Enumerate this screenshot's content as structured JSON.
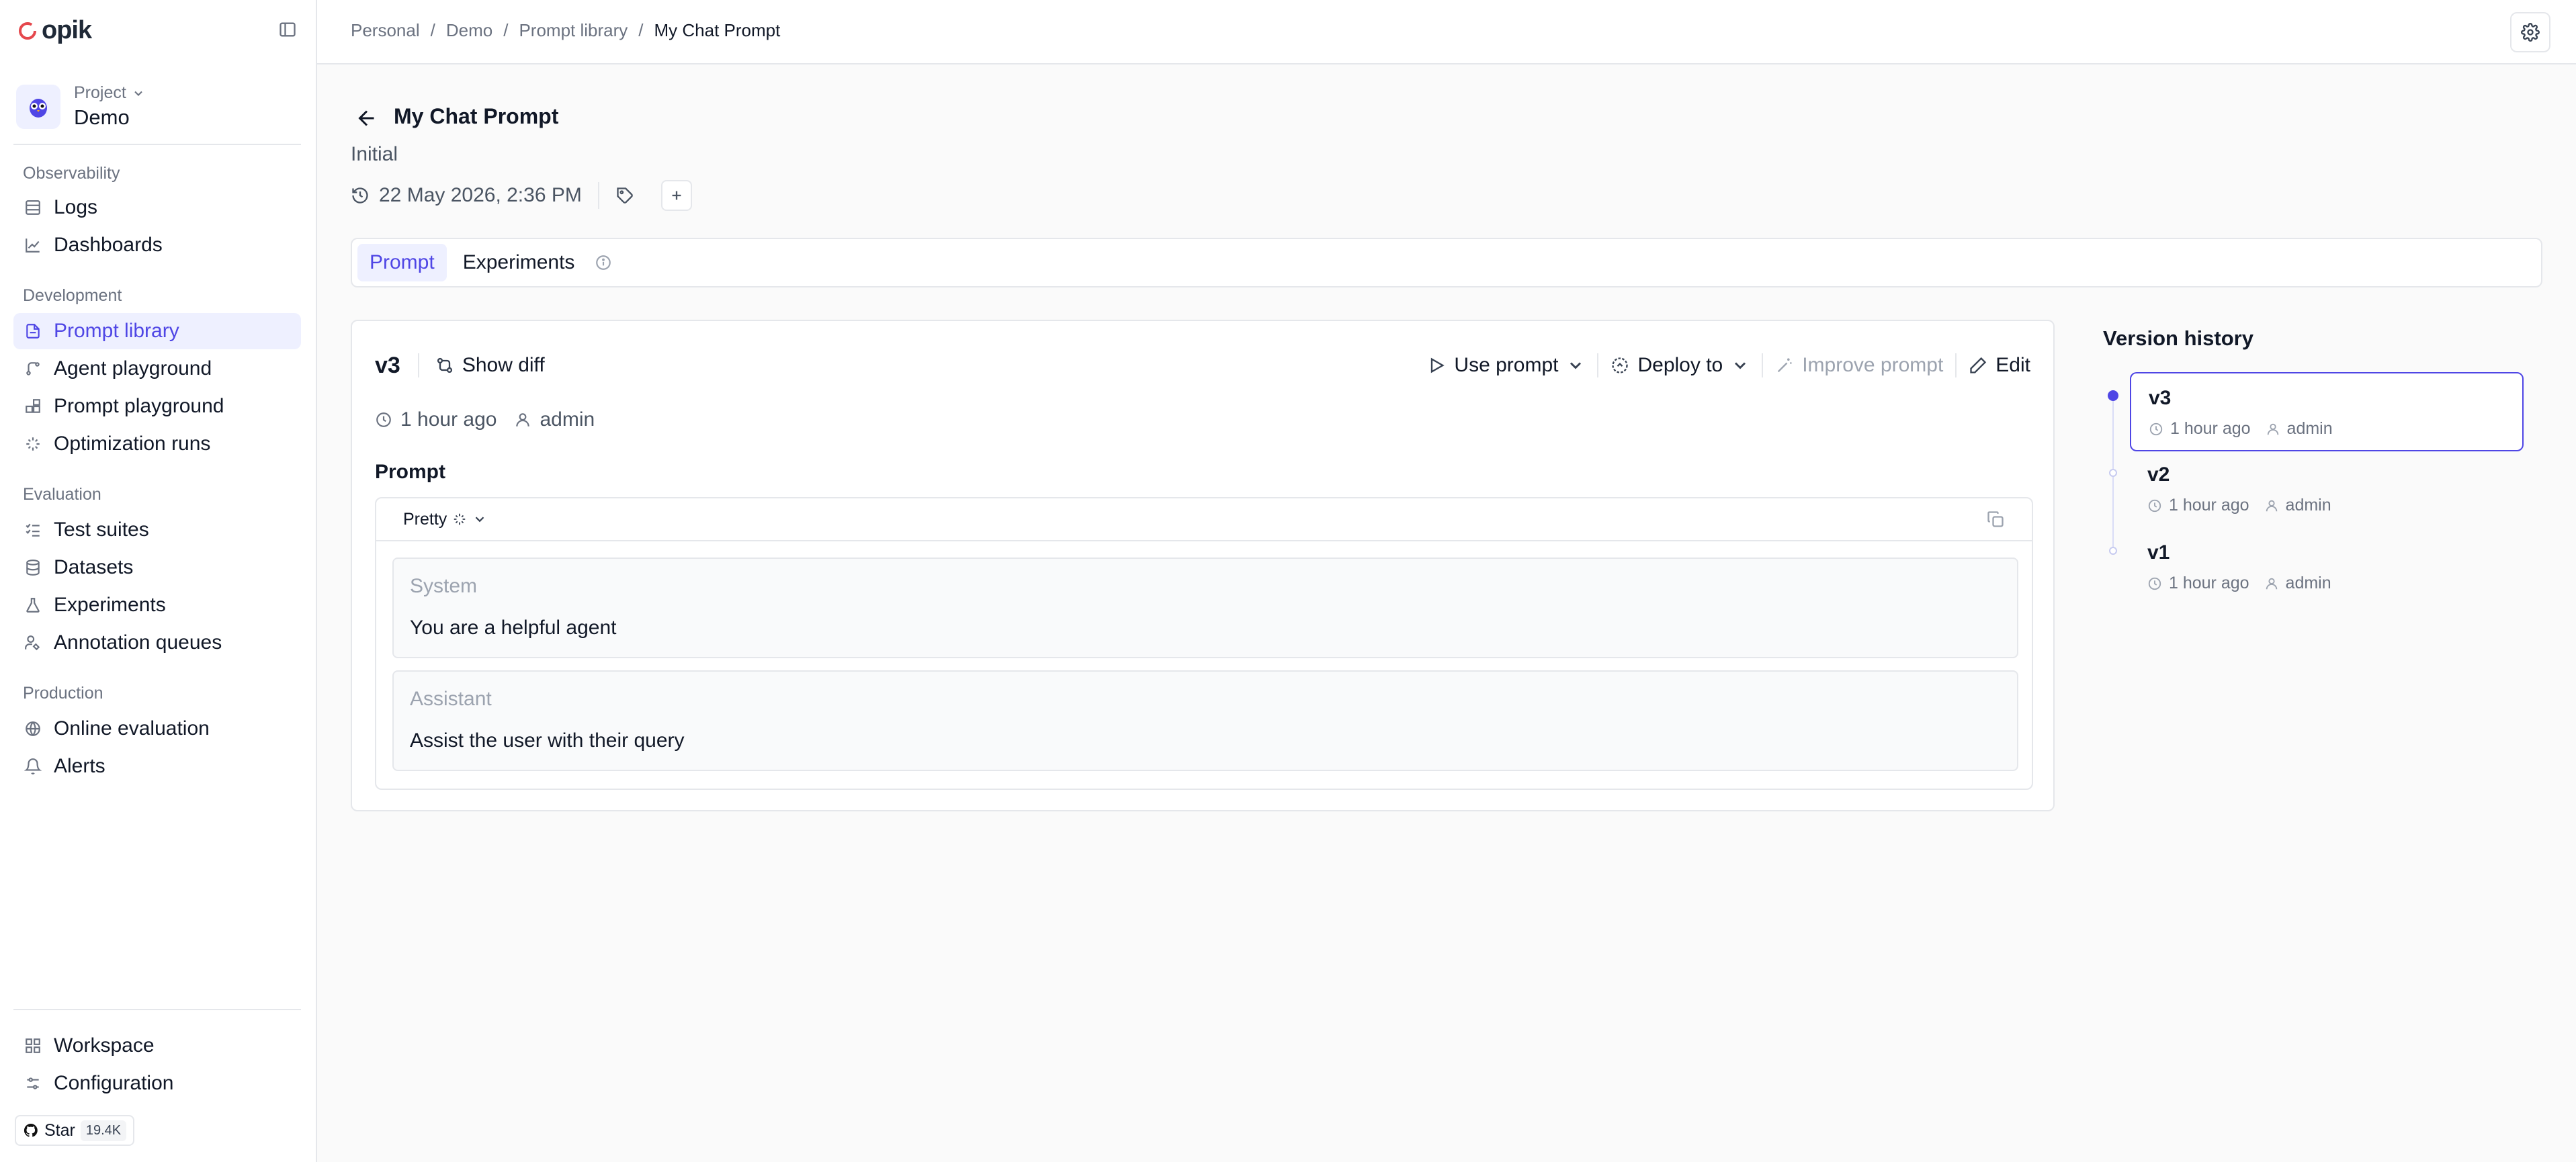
{
  "app": {
    "brand": "opik"
  },
  "sidebar": {
    "project_label": "Project",
    "project_name": "Demo",
    "sections": [
      {
        "title": "Observability",
        "items": [
          {
            "label": "Logs",
            "icon": "logs-icon"
          },
          {
            "label": "Dashboards",
            "icon": "chart-icon"
          }
        ]
      },
      {
        "title": "Development",
        "items": [
          {
            "label": "Prompt library",
            "icon": "file-icon",
            "active": true
          },
          {
            "label": "Agent playground",
            "icon": "branch-icon"
          },
          {
            "label": "Prompt playground",
            "icon": "blocks-icon"
          },
          {
            "label": "Optimization runs",
            "icon": "sparkle-icon"
          }
        ]
      },
      {
        "title": "Evaluation",
        "items": [
          {
            "label": "Test suites",
            "icon": "checklist-icon"
          },
          {
            "label": "Datasets",
            "icon": "database-icon"
          },
          {
            "label": "Experiments",
            "icon": "flask-icon"
          },
          {
            "label": "Annotation queues",
            "icon": "user-edit-icon"
          }
        ]
      },
      {
        "title": "Production",
        "items": [
          {
            "label": "Online evaluation",
            "icon": "globe-icon"
          },
          {
            "label": "Alerts",
            "icon": "bell-icon"
          }
        ]
      }
    ],
    "footer_items": [
      {
        "label": "Workspace",
        "icon": "grid-icon"
      },
      {
        "label": "Configuration",
        "icon": "sliders-icon"
      }
    ],
    "github": {
      "label": "Star",
      "count": "19.4K"
    }
  },
  "header": {
    "breadcrumbs": [
      "Personal",
      "Demo",
      "Prompt library",
      "My Chat Prompt"
    ],
    "separator": "/"
  },
  "page": {
    "title": "My Chat Prompt",
    "subtitle": "Initial",
    "date": "22 May 2026, 2:36 PM",
    "tabs": [
      {
        "label": "Prompt",
        "active": true
      },
      {
        "label": "Experiments",
        "active": false
      }
    ]
  },
  "card": {
    "version": "v3",
    "show_diff": "Show diff",
    "use_prompt": "Use prompt",
    "deploy_to": "Deploy to",
    "improve_prompt": "Improve prompt",
    "edit": "Edit",
    "time": "1 hour ago",
    "author": "admin",
    "prompt_label": "Prompt",
    "view_mode": "Pretty",
    "messages": [
      {
        "role": "System",
        "content": "You are a helpful agent"
      },
      {
        "role": "Assistant",
        "content": "Assist the user with their query"
      }
    ]
  },
  "version_history": {
    "title": "Version history",
    "versions": [
      {
        "name": "v3",
        "time": "1 hour ago",
        "author": "admin",
        "active": true
      },
      {
        "name": "v2",
        "time": "1 hour ago",
        "author": "admin",
        "active": false
      },
      {
        "name": "v1",
        "time": "1 hour ago",
        "author": "admin",
        "active": false
      }
    ]
  },
  "colors": {
    "accent": "#4f46e5",
    "accent_bg": "#eef0ff",
    "logo_red": "#e5484d"
  }
}
